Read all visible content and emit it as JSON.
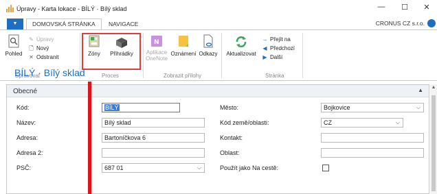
{
  "window": {
    "title": "Úpravy - Karta lokace - BÍLÝ · Bílý sklad",
    "minimize": "—",
    "maximize": "☐",
    "close": "✕"
  },
  "ribbon_tabs": {
    "menu_arrow": "▼",
    "home": "DOMOVSKÁ STRÁNKA",
    "navigate": "NAVIGACE",
    "company": "CRONUS CZ s.r.o."
  },
  "ribbon": {
    "manage": {
      "label": "Spravovat",
      "view": "Pohled",
      "edit": "Úpravy",
      "new": "Nový",
      "delete": "Odstranit"
    },
    "process": {
      "label": "Proces",
      "zones": "Zóny",
      "bins": "Přihrádky"
    },
    "attachments": {
      "label": "Zobrazit přílohy",
      "onenote_line1": "Aplikace",
      "onenote_line2": "OneNote",
      "notes": "Oznámení",
      "links": "Odkazy"
    },
    "page": {
      "label": "Stránka",
      "refresh": "Aktualizovat",
      "goto": "Přejít na",
      "previous": "Předchozí",
      "next": "Další"
    }
  },
  "page": {
    "title": "BÍLÝ · Bílý sklad",
    "fasttab": "Obecné"
  },
  "fields": {
    "code_label": "Kód:",
    "code_value": "BÍLÝ",
    "name_label": "Název:",
    "name_value": "Bílý sklad",
    "address_label": "Adresa:",
    "address_value": "Bartoníčkova 6",
    "address2_label": "Adresa 2:",
    "address2_value": "",
    "postcode_label": "PSČ:",
    "postcode_value": "687 01",
    "city_label": "Město:",
    "city_value": "Bojkovice",
    "country_label": "Kód země/oblasti:",
    "country_value": "CZ",
    "contact_label": "Kontakt:",
    "contact_value": "",
    "region_label": "Oblast:",
    "region_value": "",
    "in_transit_label": "Použít jako Na cestě:",
    "in_transit_checked": false
  },
  "colors": {
    "accent": "#1e6fc2",
    "highlight_box": "#e23b3b",
    "marker_line": "#e0121c"
  }
}
